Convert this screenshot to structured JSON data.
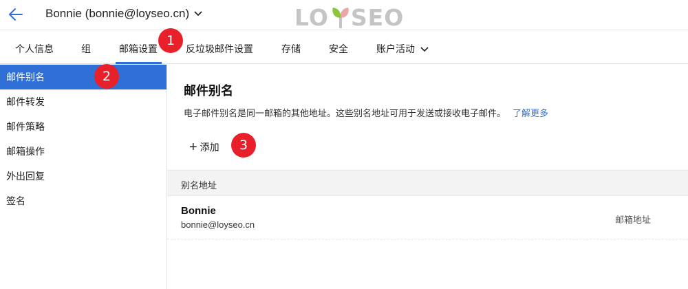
{
  "header": {
    "account_title": "Bonnie (bonnie@loyseo.cn)",
    "logo_left": "LO",
    "logo_right": "SEO"
  },
  "tabs": [
    {
      "label": "个人信息"
    },
    {
      "label": "组"
    },
    {
      "label": "邮箱设置",
      "active": true
    },
    {
      "label": "反垃圾邮件设置"
    },
    {
      "label": "存储"
    },
    {
      "label": "安全"
    },
    {
      "label": "账户活动"
    }
  ],
  "sidebar": {
    "items": [
      {
        "label": "邮件别名",
        "active": true
      },
      {
        "label": "邮件转发"
      },
      {
        "label": "邮件策略"
      },
      {
        "label": "邮箱操作"
      },
      {
        "label": "外出回复"
      },
      {
        "label": "签名"
      }
    ]
  },
  "main": {
    "title": "邮件别名",
    "description": "电子邮件别名是同一邮箱的其他地址。这些别名地址可用于发送或接收电子邮件。",
    "learn_more": "了解更多",
    "add_label": "添加",
    "table_header": "别名地址",
    "rows": [
      {
        "name": "Bonnie",
        "email": "bonnie@loyseo.cn",
        "type": "邮箱地址"
      }
    ]
  },
  "badges": [
    "1",
    "2",
    "3"
  ],
  "colors": {
    "accent": "#2f6fd6",
    "badge": "#e8202a",
    "logo_gray": "#c4c4c4",
    "logo_leaf_green": "#8cc63f",
    "logo_leaf_pink": "#e9a7a7"
  }
}
